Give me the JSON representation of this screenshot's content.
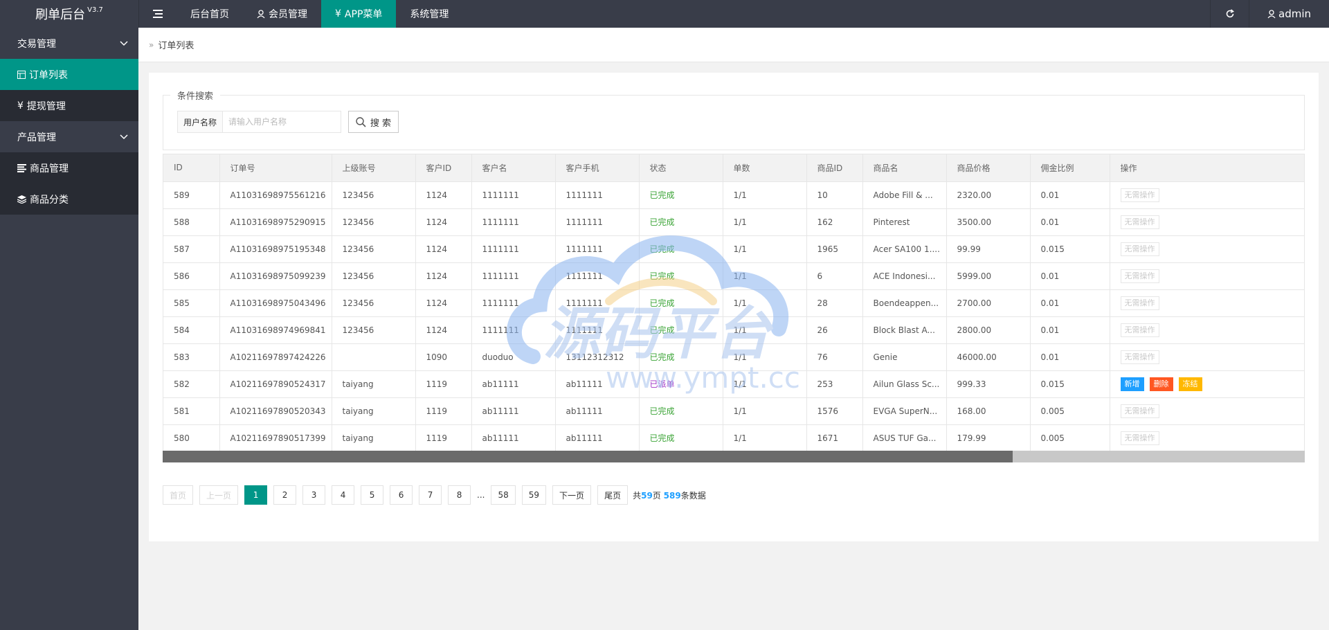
{
  "header": {
    "logo": "刷单后台",
    "version": "V3.7",
    "nav": [
      {
        "label": "后台首页"
      },
      {
        "label": "会员管理"
      },
      {
        "label": "APP菜单"
      },
      {
        "label": "系统管理"
      }
    ],
    "user": "admin"
  },
  "sidebar": {
    "groups": [
      {
        "label": "交易管理",
        "items": [
          {
            "label": "订单列表"
          },
          {
            "label": "提现管理"
          }
        ]
      },
      {
        "label": "产品管理",
        "items": [
          {
            "label": "商品管理"
          },
          {
            "label": "商品分类"
          }
        ]
      }
    ]
  },
  "breadcrumb": {
    "current": "订单列表"
  },
  "search": {
    "legend": "条件搜索",
    "label": "用户名称",
    "placeholder": "请输入用户名称",
    "button": "搜 索"
  },
  "table": {
    "columns": [
      "ID",
      "订单号",
      "上级账号",
      "客户ID",
      "客户名",
      "客户手机",
      "状态",
      "单数",
      "商品ID",
      "商品名",
      "商品价格",
      "佣金比例",
      "操作"
    ],
    "rows": [
      {
        "id": "589",
        "order": "A11031698975561216",
        "parent": "123456",
        "cid": "1124",
        "cname": "1111111",
        "phone": "1111111",
        "status": "已完成",
        "count": "1/1",
        "pid": "10",
        "pname": "Adobe Fill & ...",
        "price": "2320.00",
        "rate": "0.01",
        "op": "无需操作"
      },
      {
        "id": "588",
        "order": "A11031698975290915",
        "parent": "123456",
        "cid": "1124",
        "cname": "1111111",
        "phone": "1111111",
        "status": "已完成",
        "count": "1/1",
        "pid": "162",
        "pname": "Pinterest",
        "price": "3500.00",
        "rate": "0.01",
        "op": "无需操作"
      },
      {
        "id": "587",
        "order": "A11031698975195348",
        "parent": "123456",
        "cid": "1124",
        "cname": "1111111",
        "phone": "1111111",
        "status": "已完成",
        "count": "1/1",
        "pid": "1965",
        "pname": "Acer SA100 1....",
        "price": "99.99",
        "rate": "0.015",
        "op": "无需操作"
      },
      {
        "id": "586",
        "order": "A11031698975099239",
        "parent": "123456",
        "cid": "1124",
        "cname": "1111111",
        "phone": "1111111",
        "status": "已完成",
        "count": "1/1",
        "pid": "6",
        "pname": "ACE Indonesi...",
        "price": "5999.00",
        "rate": "0.01",
        "op": "无需操作"
      },
      {
        "id": "585",
        "order": "A11031698975043496",
        "parent": "123456",
        "cid": "1124",
        "cname": "1111111",
        "phone": "1111111",
        "status": "已完成",
        "count": "1/1",
        "pid": "28",
        "pname": "Boendeappen...",
        "price": "2700.00",
        "rate": "0.01",
        "op": "无需操作"
      },
      {
        "id": "584",
        "order": "A11031698974969841",
        "parent": "123456",
        "cid": "1124",
        "cname": "1111111",
        "phone": "1111111",
        "status": "已完成",
        "count": "1/1",
        "pid": "26",
        "pname": "Block Blast A...",
        "price": "2800.00",
        "rate": "0.01",
        "op": "无需操作"
      },
      {
        "id": "583",
        "order": "A10211697897424226",
        "parent": "",
        "cid": "1090",
        "cname": "duoduo",
        "phone": "13112312312",
        "status": "已完成",
        "count": "1/1",
        "pid": "76",
        "pname": "Genie",
        "price": "46000.00",
        "rate": "0.01",
        "op": "无需操作"
      },
      {
        "id": "582",
        "order": "A10211697890524317",
        "parent": "taiyang",
        "cid": "1119",
        "cname": "ab11111",
        "phone": "ab11111",
        "status": "已派单",
        "count": "1/1",
        "pid": "253",
        "pname": "Ailun Glass Sc...",
        "price": "999.33",
        "rate": "0.015",
        "op": "",
        "actions": [
          "新增",
          "删除",
          "冻结"
        ]
      },
      {
        "id": "581",
        "order": "A10211697890520343",
        "parent": "taiyang",
        "cid": "1119",
        "cname": "ab11111",
        "phone": "ab11111",
        "status": "已完成",
        "count": "1/1",
        "pid": "1576",
        "pname": "EVGA SuperN...",
        "price": "168.00",
        "rate": "0.005",
        "op": "无需操作"
      },
      {
        "id": "580",
        "order": "A10211697890517399",
        "parent": "taiyang",
        "cid": "1119",
        "cname": "ab11111",
        "phone": "ab11111",
        "status": "已完成",
        "count": "1/1",
        "pid": "1671",
        "pname": "ASUS TUF Ga...",
        "price": "179.99",
        "rate": "0.005",
        "op": "无需操作"
      }
    ]
  },
  "pagination": {
    "first": "首页",
    "prev": "上一页",
    "pages": [
      "1",
      "2",
      "3",
      "4",
      "5",
      "6",
      "7",
      "8"
    ],
    "ellipsis": "...",
    "tail_pages": [
      "58",
      "59"
    ],
    "next": "下一页",
    "last": "尾页",
    "info_prefix": "共",
    "total_pages": "59",
    "info_mid": "页",
    "total_count": "589",
    "info_suffix": "条数据"
  },
  "watermark": {
    "text": "源码平台",
    "url": "www.ympt.cc"
  },
  "colors": {
    "header_bg": "#393d49",
    "accent": "#009688",
    "done": "#3aa335",
    "dispatched": "#a233c6",
    "blue": "#1e9fff",
    "red": "#ff5722",
    "orange": "#ffb800"
  }
}
